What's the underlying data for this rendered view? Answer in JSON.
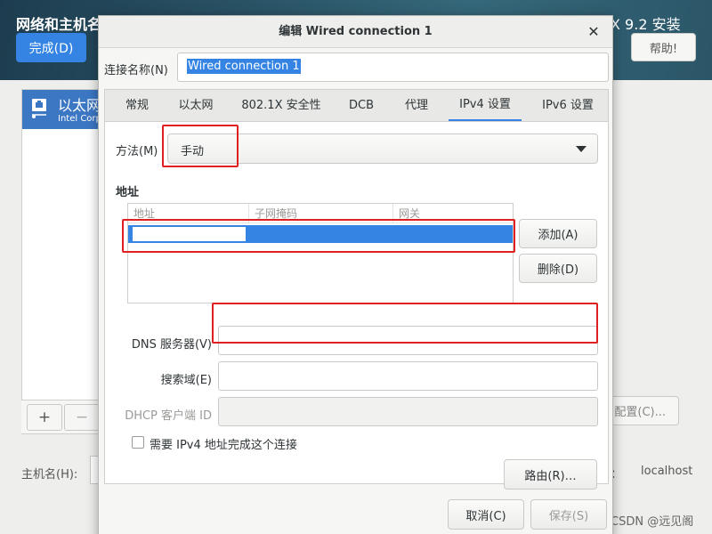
{
  "background": {
    "title": "网络和主机名",
    "done_button": "完成(D)",
    "product": "X 9.2 安装",
    "help_button": "帮助!",
    "device_name": "以太网",
    "device_sub": "Intel Corp",
    "add_button": "+",
    "remove_button": "−",
    "configure_button": "配置(C)...",
    "hostname_label": "主机名(H):",
    "current_hostname_label": "：",
    "current_hostname": "localhost",
    "watermark": "CSDN @远见阁"
  },
  "dialog": {
    "title": "编辑 Wired connection 1",
    "close_icon": "close-icon",
    "connection_name_label": "连接名称(N)",
    "connection_name_value": "Wired connection 1",
    "tabs": [
      {
        "label": "常规"
      },
      {
        "label": "以太网"
      },
      {
        "label": "802.1X 安全性"
      },
      {
        "label": "DCB"
      },
      {
        "label": "代理"
      },
      {
        "label": "IPv4 设置",
        "active": true
      },
      {
        "label": "IPv6 设置"
      }
    ],
    "ipv4": {
      "method_label": "方法(M)",
      "method_value": "手动",
      "addresses_heading": "地址",
      "columns": [
        "地址",
        "子网掩码",
        "网关"
      ],
      "rows": [
        [
          "",
          "",
          ""
        ]
      ],
      "add_button": "添加(A)",
      "delete_button": "删除(D)",
      "dns_label": "DNS 服务器(V)",
      "dns_value": "",
      "search_domain_label": "搜索域(E)",
      "search_domain_value": "",
      "dhcp_client_id_label": "DHCP 客户端 ID",
      "dhcp_client_id_value": "",
      "require_ipv4_label": "需要 IPv4 地址完成这个连接",
      "require_ipv4_checked": false,
      "routes_button": "路由(R)…"
    },
    "cancel_button": "取消(C)",
    "save_button": "保存(S)"
  },
  "colors": {
    "accent": "#3584e4",
    "highlight_box": "#e02020"
  }
}
